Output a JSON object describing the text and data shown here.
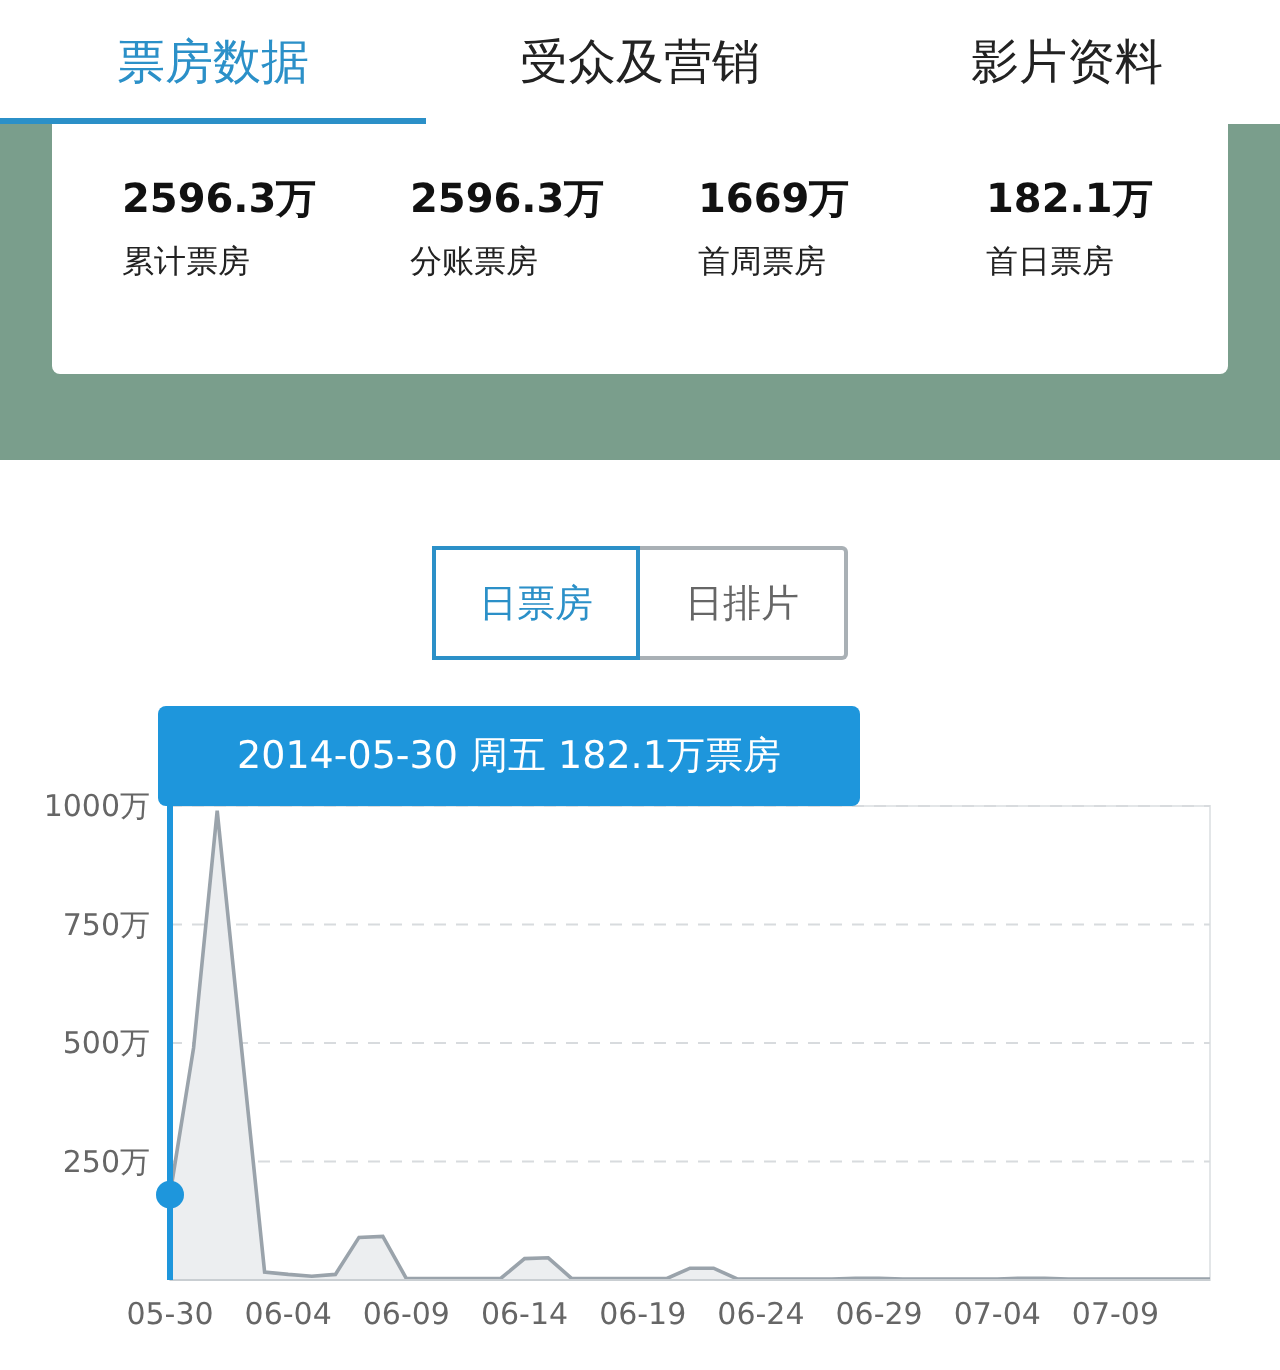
{
  "tabs": [
    {
      "label": "票房数据",
      "selected": true
    },
    {
      "label": "受众及营销",
      "selected": false
    },
    {
      "label": "影片资料",
      "selected": false
    }
  ],
  "stats": [
    {
      "value": "2596.3万",
      "label": "累计票房"
    },
    {
      "value": "2596.3万",
      "label": "分账票房"
    },
    {
      "value": "1669万",
      "label": "首周票房"
    },
    {
      "value": "182.1万",
      "label": "首日票房"
    }
  ],
  "toggle": [
    {
      "label": "日票房",
      "selected": true
    },
    {
      "label": "日排片",
      "selected": false
    }
  ],
  "chart_data": {
    "type": "area",
    "categories": [
      "05-30",
      null,
      null,
      null,
      null,
      "06-04",
      null,
      null,
      null,
      null,
      "06-09",
      null,
      null,
      null,
      null,
      "06-14",
      null,
      null,
      null,
      null,
      "06-19",
      null,
      null,
      null,
      null,
      "06-24",
      null,
      null,
      null,
      null,
      "06-29",
      null,
      null,
      null,
      null,
      "07-04",
      null,
      null,
      null,
      null,
      "07-09",
      null,
      null,
      null,
      null
    ],
    "grid": true,
    "series": [
      {
        "color": "#9aa3ab",
        "values": [
          180,
          490,
          990,
          500,
          17,
          12,
          8,
          12,
          90,
          92,
          3,
          3,
          3,
          3,
          4,
          45,
          47,
          3,
          3,
          3,
          3,
          3,
          25,
          25,
          2,
          2,
          2,
          2,
          2,
          4,
          4,
          2,
          2,
          2,
          2,
          2,
          4,
          4,
          2,
          2,
          2,
          2,
          2,
          2,
          2
        ]
      }
    ],
    "ylim": [
      0,
      1000
    ],
    "yticks": [
      {
        "value": 250,
        "label": "250万"
      },
      {
        "value": 500,
        "label": "500万"
      },
      {
        "value": 750,
        "label": "750万"
      },
      {
        "value": 1000,
        "label": "1000万"
      }
    ]
  },
  "tooltip": {
    "text": "2014-05-30 周五 182.1万票房"
  }
}
